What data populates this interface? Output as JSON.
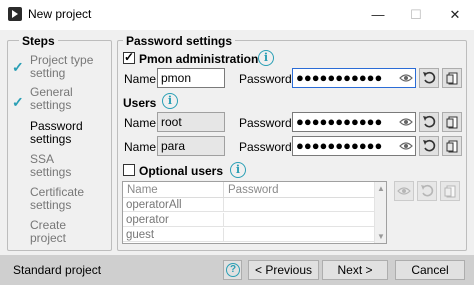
{
  "window": {
    "title": "New project",
    "minimize": "—",
    "maximize": "☐",
    "close": "✕"
  },
  "steps": {
    "title": "Steps",
    "items": [
      {
        "label1": "Project type",
        "label2": "setting"
      },
      {
        "label1": "General",
        "label2": "settings"
      },
      {
        "label1": "Password",
        "label2": "settings"
      },
      {
        "label1": "SSA",
        "label2": "settings"
      },
      {
        "label1": "Certificate",
        "label2": "settings"
      },
      {
        "label1": "Create",
        "label2": "project"
      }
    ]
  },
  "password_settings": {
    "title": "Password settings",
    "pmon": {
      "label": "Pmon administration",
      "name_label": "Name:",
      "name_value": "pmon",
      "password_label": "Password:",
      "password_value": "●●●●●●●●●●●"
    },
    "users": {
      "label": "Users",
      "rows": [
        {
          "name_label": "Name:",
          "name_value": "root",
          "password_label": "Password:",
          "password_value": "●●●●●●●●●●●"
        },
        {
          "name_label": "Name:",
          "name_value": "para",
          "password_label": "Password:",
          "password_value": "●●●●●●●●●●●"
        }
      ]
    },
    "optional_users": {
      "label": "Optional users",
      "columns": [
        "Name",
        "Password"
      ],
      "rows": [
        {
          "name": "operatorAll",
          "password": ""
        },
        {
          "name": "operator",
          "password": ""
        },
        {
          "name": "guest",
          "password": ""
        }
      ]
    }
  },
  "footer": {
    "project_type": "Standard project",
    "help": "?",
    "previous": "< Previous",
    "next": "Next >",
    "cancel": "Cancel"
  },
  "icons": {
    "info": "info-icon",
    "eye": "eye-icon",
    "reset": "reset-icon",
    "copy": "copy-icon",
    "check": "check-icon"
  },
  "colors": {
    "accent": "#2a9fb5",
    "focus_border": "#2b6cd6",
    "footer_bg": "#cfcfcf"
  }
}
